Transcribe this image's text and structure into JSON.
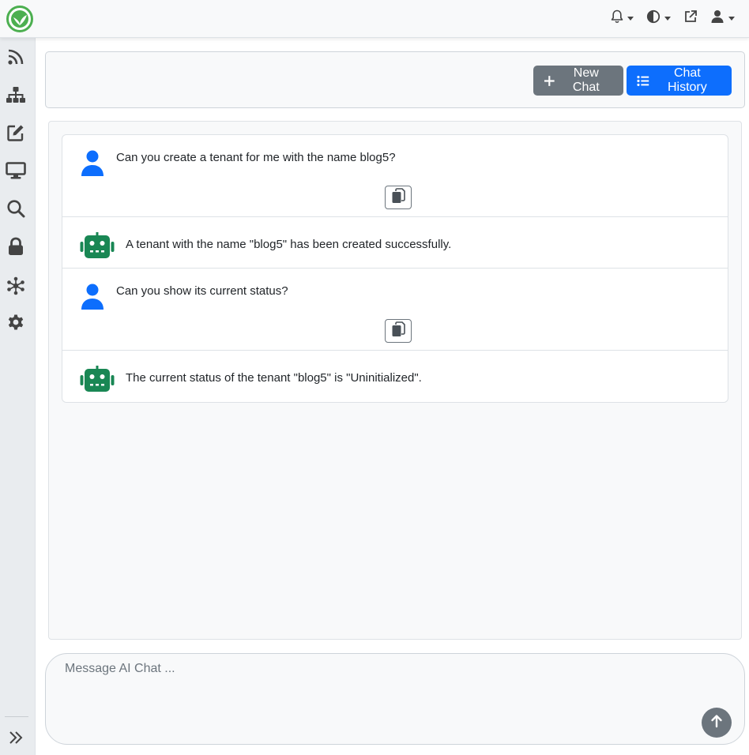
{
  "header": {
    "new_chat_label": "New Chat",
    "chat_history_label": "Chat History"
  },
  "messages": [
    {
      "role": "user",
      "text": "Can you create a tenant for me with the name blog5?"
    },
    {
      "role": "assistant",
      "text": "A tenant with the name \"blog5\" has been created successfully."
    },
    {
      "role": "user",
      "text": "Can you show its current status?"
    },
    {
      "role": "assistant",
      "text": "The current status of the tenant \"blog5\" is \"Uninitialized\"."
    }
  ],
  "composer": {
    "placeholder": "Message AI Chat ..."
  },
  "colors": {
    "primary": "#0d6efd",
    "secondary": "#6c757d",
    "bot_green": "#198754",
    "logo_green": "#4caf50"
  },
  "icons": {
    "sidebar": [
      "rss-icon",
      "sitemap-icon",
      "edit-icon",
      "desktop-icon",
      "search-icon",
      "lock-icon",
      "network-icon",
      "gear-icon"
    ],
    "topbar": [
      "bell-icon",
      "contrast-icon",
      "external-link-icon",
      "user-icon"
    ]
  }
}
